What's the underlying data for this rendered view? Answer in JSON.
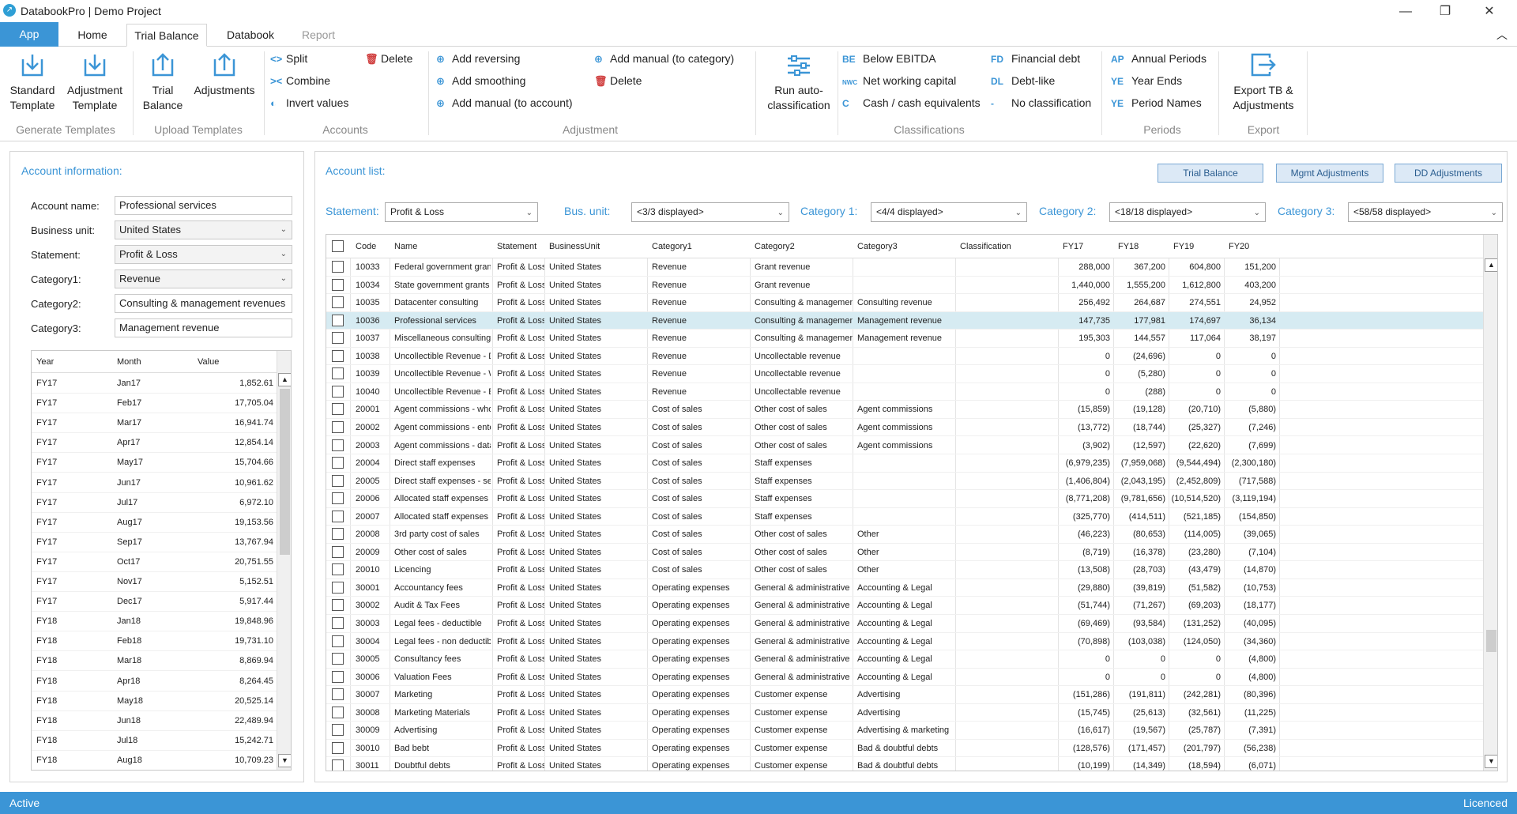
{
  "window": {
    "title": "DatabookPro | Demo Project",
    "minimize": "—",
    "maximize": "❐",
    "close": "✕"
  },
  "tabs": [
    "App",
    "Home",
    "Trial Balance",
    "Databook",
    "Report"
  ],
  "ribbon": {
    "generate": {
      "standard": [
        "Standard",
        "Template"
      ],
      "adjustment": [
        "Adjustment",
        "Template"
      ],
      "label": "Generate Templates"
    },
    "upload": {
      "trial": [
        "Trial",
        "Balance"
      ],
      "adjustments": "Adjustments",
      "label": "Upload Templates"
    },
    "accounts": {
      "split": "Split",
      "combine": "Combine",
      "invert": "Invert values",
      "delete": "Delete",
      "label": "Accounts"
    },
    "adjustment": {
      "reversing": "Add reversing",
      "smoothing": "Add smoothing",
      "manual_account": "Add manual (to account)",
      "manual_category": "Add manual (to category)",
      "delete": "Delete",
      "label": "Adjustment"
    },
    "run": [
      "Run auto-",
      "classification"
    ],
    "classifications": {
      "items": [
        {
          "code": "BE",
          "label": "Below EBITDA"
        },
        {
          "code": "NWC",
          "label": "Net working capital"
        },
        {
          "code": "C",
          "label": "Cash / cash equivalents"
        },
        {
          "code": "FD",
          "label": "Financial debt"
        },
        {
          "code": "DL",
          "label": "Debt-like"
        },
        {
          "code": "-",
          "label": "No classification"
        }
      ],
      "label": "Classifications"
    },
    "periods": {
      "items": [
        {
          "code": "AP",
          "label": "Annual Periods"
        },
        {
          "code": "YE",
          "label": "Year Ends"
        },
        {
          "code": "YE",
          "label": "Period Names"
        }
      ],
      "label": "Periods"
    },
    "export": {
      "button": [
        "Export TB &",
        "Adjustments"
      ],
      "label": "Export"
    }
  },
  "account_info": {
    "title": "Account information:",
    "fields": [
      {
        "label": "Account name:",
        "value": "Professional services",
        "dropdown": false
      },
      {
        "label": "Business unit:",
        "value": "United States",
        "dropdown": true
      },
      {
        "label": "Statement:",
        "value": "Profit & Loss",
        "dropdown": true
      },
      {
        "label": "Category1:",
        "value": "Revenue",
        "dropdown": true
      },
      {
        "label": "Category2:",
        "value": "Consulting & management revenues",
        "dropdown": false
      },
      {
        "label": "Category3:",
        "value": "Management revenue",
        "dropdown": false
      }
    ],
    "grid": {
      "headers": [
        "Year",
        "Month",
        "Value"
      ],
      "rows": [
        [
          "FY17",
          "Jan17",
          "1,852.61"
        ],
        [
          "FY17",
          "Feb17",
          "17,705.04"
        ],
        [
          "FY17",
          "Mar17",
          "16,941.74"
        ],
        [
          "FY17",
          "Apr17",
          "12,854.14"
        ],
        [
          "FY17",
          "May17",
          "15,704.66"
        ],
        [
          "FY17",
          "Jun17",
          "10,961.62"
        ],
        [
          "FY17",
          "Jul17",
          "6,972.10"
        ],
        [
          "FY17",
          "Aug17",
          "19,153.56"
        ],
        [
          "FY17",
          "Sep17",
          "13,767.94"
        ],
        [
          "FY17",
          "Oct17",
          "20,751.55"
        ],
        [
          "FY17",
          "Nov17",
          "5,152.51"
        ],
        [
          "FY17",
          "Dec17",
          "5,917.44"
        ],
        [
          "FY18",
          "Jan18",
          "19,848.96"
        ],
        [
          "FY18",
          "Feb18",
          "19,731.10"
        ],
        [
          "FY18",
          "Mar18",
          "8,869.94"
        ],
        [
          "FY18",
          "Apr18",
          "8,264.45"
        ],
        [
          "FY18",
          "May18",
          "20,525.14"
        ],
        [
          "FY18",
          "Jun18",
          "22,489.94"
        ],
        [
          "FY18",
          "Jul18",
          "15,242.71"
        ],
        [
          "FY18",
          "Aug18",
          "10,709.23"
        ]
      ]
    }
  },
  "account_list": {
    "title": "Account list:",
    "buttons": [
      "Trial Balance",
      "Mgmt Adjustments",
      "DD Adjustments"
    ],
    "filters": [
      {
        "label": "Statement:",
        "value": "Profit & Loss"
      },
      {
        "label": "Bus. unit:",
        "value": "<3/3 displayed>"
      },
      {
        "label": "Category 1:",
        "value": "<4/4 displayed>"
      },
      {
        "label": "Category 2:",
        "value": "<18/18 displayed>"
      },
      {
        "label": "Category 3:",
        "value": "<58/58 displayed>"
      }
    ],
    "headers": [
      "Code",
      "Name",
      "Statement",
      "BusinessUnit",
      "Category1",
      "Category2",
      "Category3",
      "Classification",
      "FY17",
      "FY18",
      "FY19",
      "FY20"
    ],
    "selected_code": "10036",
    "rows": [
      [
        "10033",
        "Federal government grants",
        "Profit & Loss",
        "United States",
        "Revenue",
        "Grant revenue",
        "",
        "",
        "288,000",
        "367,200",
        "604,800",
        "151,200"
      ],
      [
        "10034",
        "State government grants",
        "Profit & Loss",
        "United States",
        "Revenue",
        "Grant revenue",
        "",
        "",
        "1,440,000",
        "1,555,200",
        "1,612,800",
        "403,200"
      ],
      [
        "10035",
        "Datacenter consulting",
        "Profit & Loss",
        "United States",
        "Revenue",
        "Consulting & management rev",
        "Consulting revenue",
        "",
        "256,492",
        "264,687",
        "274,551",
        "24,952"
      ],
      [
        "10036",
        "Professional services",
        "Profit & Loss",
        "United States",
        "Revenue",
        "Consulting & management rev",
        "Management revenue",
        "",
        "147,735",
        "177,981",
        "174,697",
        "36,134"
      ],
      [
        "10037",
        "Miscellaneous consulting",
        "Profit & Loss",
        "United States",
        "Revenue",
        "Consulting & management rev",
        "Management revenue",
        "",
        "195,303",
        "144,557",
        "117,064",
        "38,197"
      ],
      [
        "10038",
        "Uncollectible Revenue - Datace",
        "Profit & Loss",
        "United States",
        "Revenue",
        "Uncollectable revenue",
        "",
        "",
        "0",
        "(24,696)",
        "0",
        "0"
      ],
      [
        "10039",
        "Uncollectible Revenue - Whole",
        "Profit & Loss",
        "United States",
        "Revenue",
        "Uncollectable revenue",
        "",
        "",
        "0",
        "(5,280)",
        "0",
        "0"
      ],
      [
        "10040",
        "Uncollectible Revenue - Enterp",
        "Profit & Loss",
        "United States",
        "Revenue",
        "Uncollectable revenue",
        "",
        "",
        "0",
        "(288)",
        "0",
        "0"
      ],
      [
        "20001",
        "Agent commissions - wholesal",
        "Profit & Loss",
        "United States",
        "Cost of sales",
        "Other cost of sales",
        "Agent commissions",
        "",
        "(15,859)",
        "(19,128)",
        "(20,710)",
        "(5,880)"
      ],
      [
        "20002",
        "Agent commissions - enterpris",
        "Profit & Loss",
        "United States",
        "Cost of sales",
        "Other cost of sales",
        "Agent commissions",
        "",
        "(13,772)",
        "(18,744)",
        "(25,327)",
        "(7,246)"
      ],
      [
        "20003",
        "Agent commissions - datacent",
        "Profit & Loss",
        "United States",
        "Cost of sales",
        "Other cost of sales",
        "Agent commissions",
        "",
        "(3,902)",
        "(12,597)",
        "(22,620)",
        "(7,699)"
      ],
      [
        "20004",
        "Direct staff expenses",
        "Profit & Loss",
        "United States",
        "Cost of sales",
        "Staff expenses",
        "",
        "",
        "(6,979,235)",
        "(7,959,068)",
        "(9,544,494)",
        "(2,300,180)"
      ],
      [
        "20005",
        "Direct staff expenses - set up",
        "Profit & Loss",
        "United States",
        "Cost of sales",
        "Staff expenses",
        "",
        "",
        "(1,406,804)",
        "(2,043,195)",
        "(2,452,809)",
        "(717,588)"
      ],
      [
        "20006",
        "Allocated staff expenses",
        "Profit & Loss",
        "United States",
        "Cost of sales",
        "Staff expenses",
        "",
        "",
        "(8,771,208)",
        "(9,781,656)",
        "(10,514,520)",
        "(3,119,194)"
      ],
      [
        "20007",
        "Allocated staff expenses - set u",
        "Profit & Loss",
        "United States",
        "Cost of sales",
        "Staff expenses",
        "",
        "",
        "(325,770)",
        "(414,511)",
        "(521,185)",
        "(154,850)"
      ],
      [
        "20008",
        "3rd party cost of sales",
        "Profit & Loss",
        "United States",
        "Cost of sales",
        "Other cost of sales",
        "Other",
        "",
        "(46,223)",
        "(80,653)",
        "(114,005)",
        "(39,065)"
      ],
      [
        "20009",
        "Other cost of sales",
        "Profit & Loss",
        "United States",
        "Cost of sales",
        "Other cost of sales",
        "Other",
        "",
        "(8,719)",
        "(16,378)",
        "(23,280)",
        "(7,104)"
      ],
      [
        "20010",
        "Licencing",
        "Profit & Loss",
        "United States",
        "Cost of sales",
        "Other cost of sales",
        "Other",
        "",
        "(13,508)",
        "(28,703)",
        "(43,479)",
        "(14,870)"
      ],
      [
        "30001",
        "Accountancy fees",
        "Profit & Loss",
        "United States",
        "Operating expenses",
        "General & administrative",
        "Accounting & Legal",
        "",
        "(29,880)",
        "(39,819)",
        "(51,582)",
        "(10,753)"
      ],
      [
        "30002",
        "Audit & Tax Fees",
        "Profit & Loss",
        "United States",
        "Operating expenses",
        "General & administrative",
        "Accounting & Legal",
        "",
        "(51,744)",
        "(71,267)",
        "(69,203)",
        "(18,177)"
      ],
      [
        "30003",
        "Legal fees - deductible",
        "Profit & Loss",
        "United States",
        "Operating expenses",
        "General & administrative",
        "Accounting & Legal",
        "",
        "(69,469)",
        "(93,584)",
        "(131,252)",
        "(40,095)"
      ],
      [
        "30004",
        "Legal fees - non deductible",
        "Profit & Loss",
        "United States",
        "Operating expenses",
        "General & administrative",
        "Accounting & Legal",
        "",
        "(70,898)",
        "(103,038)",
        "(124,050)",
        "(34,360)"
      ],
      [
        "30005",
        "Consultancy fees",
        "Profit & Loss",
        "United States",
        "Operating expenses",
        "General & administrative",
        "Accounting & Legal",
        "",
        "0",
        "0",
        "0",
        "(4,800)"
      ],
      [
        "30006",
        "Valuation Fees",
        "Profit & Loss",
        "United States",
        "Operating expenses",
        "General & administrative",
        "Accounting & Legal",
        "",
        "0",
        "0",
        "0",
        "(4,800)"
      ],
      [
        "30007",
        "Marketing",
        "Profit & Loss",
        "United States",
        "Operating expenses",
        "Customer expense",
        "Advertising",
        "",
        "(151,286)",
        "(191,811)",
        "(242,281)",
        "(80,396)"
      ],
      [
        "30008",
        "Marketing Materials",
        "Profit & Loss",
        "United States",
        "Operating expenses",
        "Customer expense",
        "Advertising",
        "",
        "(15,745)",
        "(25,613)",
        "(32,561)",
        "(11,225)"
      ],
      [
        "30009",
        "Advertising",
        "Profit & Loss",
        "United States",
        "Operating expenses",
        "Customer expense",
        "Advertising & marketing",
        "",
        "(16,617)",
        "(19,567)",
        "(25,787)",
        "(7,391)"
      ],
      [
        "30010",
        "Bad bebt",
        "Profit & Loss",
        "United States",
        "Operating expenses",
        "Customer expense",
        "Bad & doubtful debts",
        "",
        "(128,576)",
        "(171,457)",
        "(201,797)",
        "(56,238)"
      ],
      [
        "30011",
        "Doubtful debts",
        "Profit & Loss",
        "United States",
        "Operating expenses",
        "Customer expense",
        "Bad & doubtful debts",
        "",
        "(10,199)",
        "(14,349)",
        "(18,594)",
        "(6,071)"
      ]
    ]
  },
  "status": {
    "left": "Active",
    "right": "Licenced"
  },
  "colors": {
    "accent": "#3b95d6",
    "selected_row": "#d6ebf2",
    "delete": "#d04040"
  }
}
